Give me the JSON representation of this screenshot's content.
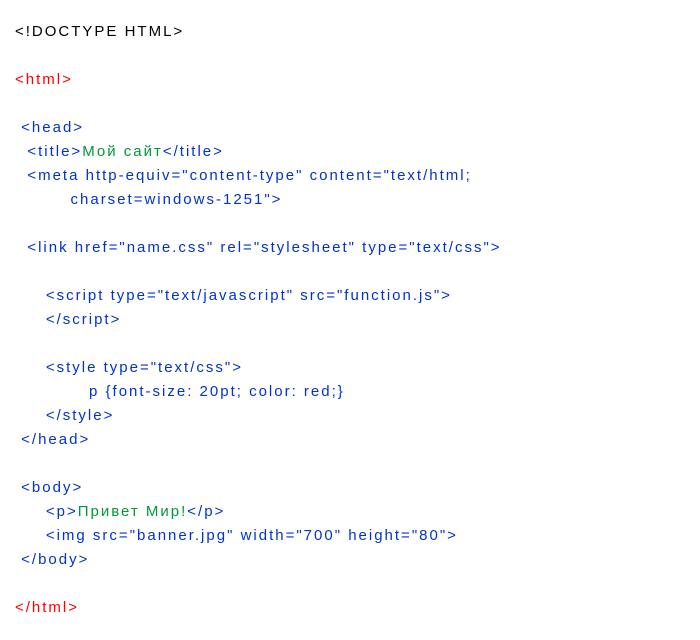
{
  "lines": {
    "l1": "<!DOCTYPE HTML>",
    "l2": "<html>",
    "l3": " <head>",
    "l4a": "  <title>",
    "l4b": "Мой сайт",
    "l4c": "</title>",
    "l5": "  <meta http-equiv=\"content-type\" content=\"text/html;",
    "l6": "         charset=windows-1251\">",
    "l7": "  <link href=\"name.css\" rel=\"stylesheet\" type=\"text/css\">",
    "l8": "     <script type=\"text/javascript\" src=\"function.js\">",
    "l9": "     </script>",
    "l10": "     <style type=\"text/css\">",
    "l11": "            p {font-size: 20pt; color: red;}",
    "l12": "     </style>",
    "l13": " </head>",
    "l14": " <body>",
    "l15a": "     <p>",
    "l15b": "Привет Мир!",
    "l15c": "</p>",
    "l16": "     <img src=\"banner.jpg\" width=\"700\" height=\"80\">",
    "l17": " </body>",
    "l18": "</html>"
  }
}
